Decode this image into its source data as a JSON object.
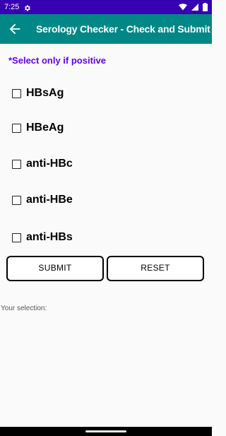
{
  "status_bar": {
    "time": "7:25",
    "icons": [
      "gear-icon",
      "wifi-icon",
      "signal-icon",
      "battery-icon"
    ],
    "background": "#3700b3"
  },
  "app_bar": {
    "title": "Serology Checker - Check and Submit",
    "back_icon": "arrow-back-icon",
    "background": "#018786"
  },
  "hint": {
    "text": "*Select only if positive",
    "color": "#6200ee"
  },
  "markers": [
    {
      "label": "HBsAg",
      "checked": false
    },
    {
      "label": "HBeAg",
      "checked": false
    },
    {
      "label": "anti-HBc",
      "checked": false
    },
    {
      "label": "anti-HBe",
      "checked": false
    },
    {
      "label": "anti-HBs",
      "checked": false
    }
  ],
  "buttons": {
    "submit": "SUBMIT",
    "reset": "RESET"
  },
  "selection": {
    "label": "Your selection:"
  }
}
